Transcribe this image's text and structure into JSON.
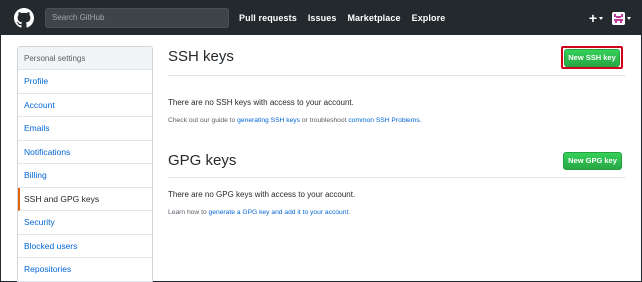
{
  "header": {
    "search_placeholder": "Search GitHub",
    "nav": [
      "Pull requests",
      "Issues",
      "Marketplace",
      "Explore"
    ],
    "plus_label": "+"
  },
  "sidebar": {
    "heading": "Personal settings",
    "items": [
      {
        "label": "Profile",
        "active": false
      },
      {
        "label": "Account",
        "active": false
      },
      {
        "label": "Emails",
        "active": false
      },
      {
        "label": "Notifications",
        "active": false
      },
      {
        "label": "Billing",
        "active": false
      },
      {
        "label": "SSH and GPG keys",
        "active": true
      },
      {
        "label": "Security",
        "active": false
      },
      {
        "label": "Blocked users",
        "active": false
      },
      {
        "label": "Repositories",
        "active": false
      }
    ]
  },
  "ssh": {
    "title": "SSH keys",
    "button": "New SSH key",
    "empty": "There are no SSH keys with access to your account.",
    "help_prefix": "Check out our guide to ",
    "help_link1": "generating SSH keys",
    "help_mid": " or troubleshoot ",
    "help_link2": "common SSH Problems",
    "help_suffix": "."
  },
  "gpg": {
    "title": "GPG keys",
    "button": "New GPG key",
    "empty": "There are no GPG keys with access to your account.",
    "help_prefix": "Learn how to ",
    "help_link": "generate a GPG key and add it to your account",
    "help_suffix": "."
  },
  "colors": {
    "header_bg": "#24292e",
    "link": "#0366d6",
    "button_green": "#28a745",
    "active_marker": "#e36209",
    "highlight_red": "#d0021b"
  }
}
